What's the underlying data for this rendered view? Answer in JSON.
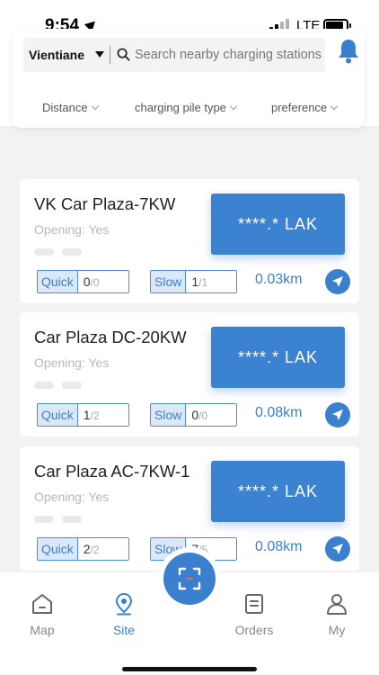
{
  "status_bar": {
    "time": "9:54",
    "network": "LTE"
  },
  "header": {
    "city": "Vientiane",
    "search_placeholder": "Search nearby charging stations",
    "filters": [
      "Distance",
      "charging pile type",
      "preference"
    ]
  },
  "stations": [
    {
      "name": "VK Car Plaza-7KW",
      "opening": "Opening: Yes",
      "price": "****.* LAK",
      "quick_label": "Quick",
      "quick_available": "0",
      "quick_total": "/0",
      "slow_label": "Slow",
      "slow_available": "1",
      "slow_total": "/1",
      "distance": "0.03km"
    },
    {
      "name": "Car Plaza DC-20KW",
      "opening": "Opening: Yes",
      "price": "****.* LAK",
      "quick_label": "Quick",
      "quick_available": "1",
      "quick_total": "/2",
      "slow_label": "Slow",
      "slow_available": "0",
      "slow_total": "/0",
      "distance": "0.08km"
    },
    {
      "name": "Car Plaza AC-7KW-1",
      "opening": "Opening: Yes",
      "price": "****.* LAK",
      "quick_label": "Quick",
      "quick_available": "2",
      "quick_total": "/2",
      "slow_label": "Slow",
      "slow_available": "7",
      "slow_total": "/5",
      "distance": "0.08km"
    }
  ],
  "tabbar": {
    "items": [
      "Map",
      "Site",
      "Orders",
      "My"
    ],
    "active": "Site"
  },
  "colors": {
    "accent": "#3b7fcf",
    "price_bg": "#3b82d0",
    "tag_bg": "#dbe8f8"
  },
  "icons": [
    "location-arrow-icon",
    "signal-icon",
    "battery-icon",
    "search-icon",
    "bell-icon",
    "chevron-down-icon",
    "navigate-icon",
    "home-icon",
    "location-pin-icon",
    "scan-icon",
    "orders-icon",
    "user-icon"
  ]
}
